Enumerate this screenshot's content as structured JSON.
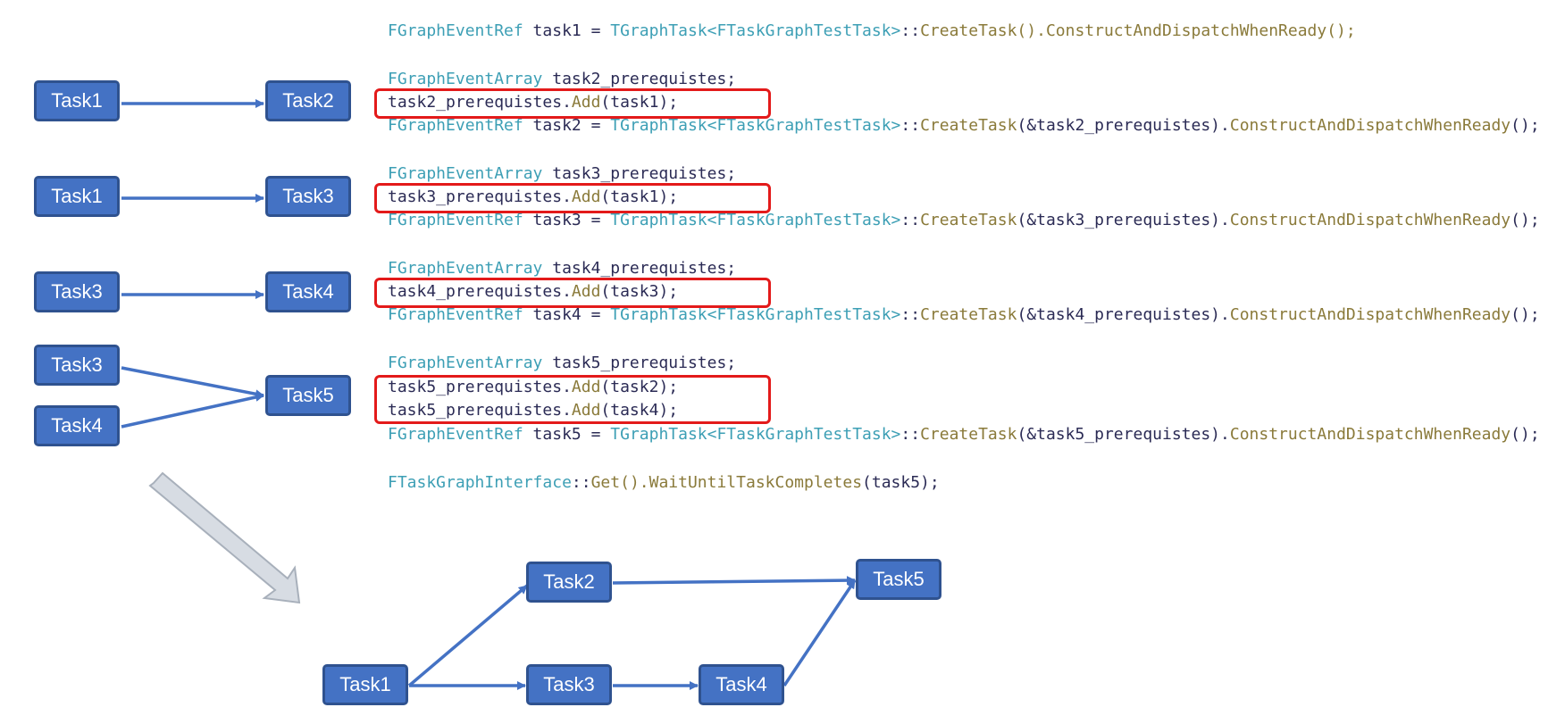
{
  "colors": {
    "node_fill": "#4472c4",
    "node_border": "#2f528f",
    "edge": "#4472c4",
    "highlight": "#e31a1a",
    "type_color": "#3d9fb5",
    "func_color": "#8a7a3a"
  },
  "left_diagrams": [
    {
      "from": [
        "Task1"
      ],
      "to": "Task2"
    },
    {
      "from": [
        "Task1"
      ],
      "to": "Task3"
    },
    {
      "from": [
        "Task3"
      ],
      "to": "Task4"
    },
    {
      "from": [
        "Task3",
        "Task4"
      ],
      "to": "Task5"
    }
  ],
  "code": {
    "line1": {
      "type": "FGraphEventRef",
      "mid": " task1 = ",
      "type2": "TGraphTask<FTaskGraphTestTask>",
      "sep": "::",
      "func": "CreateTask().ConstructAndDispatchWhenReady();"
    },
    "l2a": {
      "type": "FGraphEventArray",
      "rest": " task2_prerequistes;"
    },
    "l2b": {
      "var": "task2_prerequistes.",
      "func": "Add",
      "rest": "(task1);"
    },
    "l2c": {
      "type": "FGraphEventRef",
      "mid": " task2 = ",
      "type2": "TGraphTask<FTaskGraphTestTask>",
      "sep": "::",
      "func": "CreateTask",
      "arg": "(&task2_prerequistes).",
      "func2": "ConstructAndDispatchWhenReady",
      "end": "();"
    },
    "l3a": {
      "type": "FGraphEventArray",
      "rest": " task3_prerequistes;"
    },
    "l3b": {
      "var": "task3_prerequistes.",
      "func": "Add",
      "rest": "(task1);"
    },
    "l3c": {
      "type": "FGraphEventRef",
      "mid": " task3 = ",
      "type2": "TGraphTask<FTaskGraphTestTask>",
      "sep": "::",
      "func": "CreateTask",
      "arg": "(&task3_prerequistes).",
      "func2": "ConstructAndDispatchWhenReady",
      "end": "();"
    },
    "l4a": {
      "type": "FGraphEventArray",
      "rest": " task4_prerequistes;"
    },
    "l4b": {
      "var": "task4_prerequistes.",
      "func": "Add",
      "rest": "(task3);"
    },
    "l4c": {
      "type": "FGraphEventRef",
      "mid": " task4 = ",
      "type2": "TGraphTask<FTaskGraphTestTask>",
      "sep": "::",
      "func": "CreateTask",
      "arg": "(&task4_prerequistes).",
      "func2": "ConstructAndDispatchWhenReady",
      "end": "();"
    },
    "l5a": {
      "type": "FGraphEventArray",
      "rest": " task5_prerequistes;"
    },
    "l5b": {
      "var": "task5_prerequistes.",
      "func": "Add",
      "rest": "(task2);"
    },
    "l5c": {
      "var": "task5_prerequistes.",
      "func": "Add",
      "rest": "(task4);"
    },
    "l5d": {
      "type": "FGraphEventRef",
      "mid": " task5 = ",
      "type2": "TGraphTask<FTaskGraphTestTask>",
      "sep": "::",
      "func": "CreateTask",
      "arg": "(&task5_prerequistes).",
      "func2": "ConstructAndDispatchWhenReady",
      "end": "();"
    },
    "l6": {
      "type": "FTaskGraphInterface",
      "sep": "::",
      "func": "Get().WaitUntilTaskCompletes",
      "rest": "(task5);"
    }
  },
  "merged_graph": {
    "nodes": {
      "t1": "Task1",
      "t2": "Task2",
      "t3": "Task3",
      "t4": "Task4",
      "t5": "Task5"
    },
    "edges": [
      [
        "Task1",
        "Task2"
      ],
      [
        "Task1",
        "Task3"
      ],
      [
        "Task3",
        "Task4"
      ],
      [
        "Task2",
        "Task5"
      ],
      [
        "Task4",
        "Task5"
      ]
    ]
  }
}
